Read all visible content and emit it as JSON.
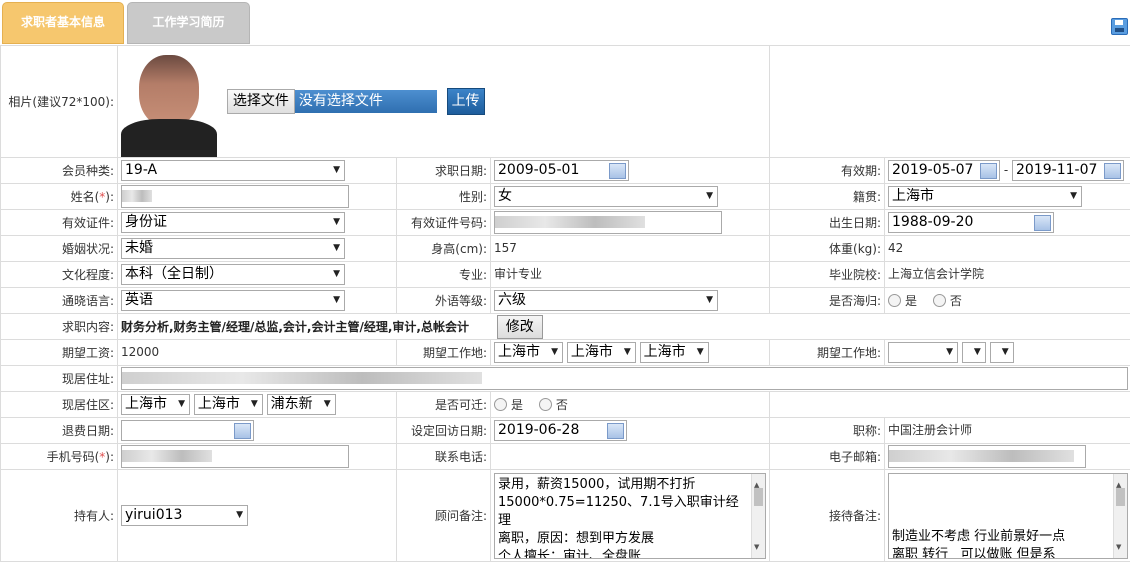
{
  "tabs": {
    "basic": "求职者基本信息",
    "history": "工作学习简历"
  },
  "photo": {
    "label": "相片(建议72*100):",
    "choose_file": "选择文件",
    "no_file": "没有选择文件",
    "upload": "上传"
  },
  "labels": {
    "member_type": "会员种类:",
    "apply_date": "求职日期:",
    "valid_period": "有效期:",
    "name": "姓名(",
    "req_mark": "*",
    "name_end": "):",
    "gender": "性别:",
    "native": "籍贯:",
    "id_type": "有效证件:",
    "id_no": "有效证件号码:",
    "birth": "出生日期:",
    "marital": "婚姻状况:",
    "height": "身高(cm):",
    "weight": "体重(kg):",
    "education": "文化程度:",
    "major": "专业:",
    "school": "毕业院校:",
    "language": "通晓语言:",
    "lang_level": "外语等级:",
    "overseas": "是否海归:",
    "job_content": "求职内容:",
    "salary": "期望工资:",
    "exp_loc": "期望工作地:",
    "exp_loc2": "期望工作地:",
    "address": "现居住址:",
    "district": "现居住区:",
    "relocate": "是否可迁:",
    "refund_date": "退费日期:",
    "visit_date": "设定回访日期:",
    "title": "职称:",
    "mobile": "手机号码(",
    "mobile_end": "):",
    "phone": "联系电话:",
    "email": "电子邮箱:",
    "holder": "持有人:",
    "advisor_note": "顾问备注:",
    "reception_note": "接待备注:"
  },
  "values": {
    "member_type": "19-A",
    "apply_date": "2009-05-01",
    "valid_from": "2019-05-07",
    "valid_dash": "-",
    "valid_to": "2019-11-07",
    "gender": "女",
    "native": "上海市",
    "id_type": "身份证",
    "birth": "1988-09-20",
    "marital": "未婚",
    "height": "157",
    "weight": "42",
    "education": "本科（全日制）",
    "major": "审计专业",
    "school": "上海立信会计学院",
    "language": "英语",
    "lang_level": "六级",
    "yes": "是",
    "no": "否",
    "job_content": "财务分析,财务主管/经理/总监,会计,会计主管/经理,审计,总帐会计",
    "modify": "修改",
    "salary": "12000",
    "exp_loc": [
      "上海市",
      "上海市",
      "上海市"
    ],
    "district": [
      "上海市",
      "上海市",
      "浦东新"
    ],
    "visit_date": "2019-06-28",
    "title": "中国注册会计师",
    "holder": "yirui013",
    "advisor_note": "录用，薪资15000，试用期不打折15000*0.75=11250、7.1号入职审计经理\n离职，原因：想到甲方发展\n个人擅长：审计、全盘账",
    "reception_note": "制造业不考虑 行业前景好一点\n离职 转行   可以做账 但是系"
  },
  "icons": {
    "save": "save-icon",
    "calendar": "calendar-icon"
  },
  "colors": {
    "tab_active": "#f6c76e",
    "tab_inactive": "#c9c9c9",
    "required": "#e05050",
    "upload_btn": "#2a6cb8"
  }
}
